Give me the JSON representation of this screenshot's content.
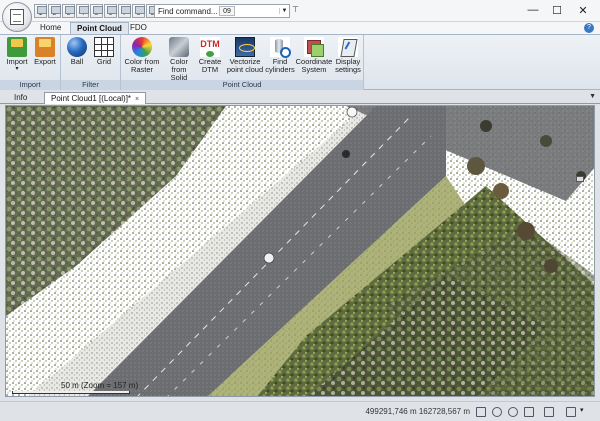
{
  "quick_access": {
    "buttons": [
      "1",
      "2",
      "3",
      "4",
      "5",
      "6",
      "7",
      "8",
      "9"
    ],
    "find_placeholder": "Find command...",
    "find_value": "09"
  },
  "window": {
    "minimize": "—",
    "maximize": "☐",
    "close": "✕"
  },
  "ribbon_tabs": [
    {
      "label": "Home"
    },
    {
      "label": "Point Cloud",
      "active": true
    },
    {
      "label": "FDO"
    }
  ],
  "ribbon": {
    "groups": [
      {
        "label": "Import",
        "buttons": [
          {
            "label": "Import",
            "icon": "import-icon",
            "dropdown": "▾"
          },
          {
            "label": "Export",
            "icon": "export-icon"
          }
        ]
      },
      {
        "label": "Filter",
        "buttons": [
          {
            "label": "Ball",
            "icon": "ball-icon"
          },
          {
            "label": "Grid",
            "icon": "grid-icon"
          }
        ]
      },
      {
        "label": "Point Cloud",
        "buttons": [
          {
            "label": "Color from\nRaster",
            "icon": "color-wheel-icon"
          },
          {
            "label": "Color\nfrom Solid",
            "icon": "solid-color-icon"
          },
          {
            "label": "Create\nDTM",
            "icon": "dtm-icon",
            "icon_text": "DTM"
          },
          {
            "label": "Vectorize\npoint cloud",
            "icon": "vectorize-icon"
          },
          {
            "label": "Find\ncylinders",
            "icon": "cylinder-icon"
          },
          {
            "label": "Coordinate\nSystem",
            "icon": "coordinate-system-icon"
          },
          {
            "label": "Display\nsettings",
            "icon": "display-settings-icon"
          }
        ]
      }
    ]
  },
  "doc_tabs": {
    "info": "Info",
    "active": "Point Cloud1 [(Local)]*",
    "close": "×"
  },
  "viewport": {
    "scale_label": "50 m (Zoom = 157 m)"
  },
  "status": {
    "coordinates": "499291,746 m 162728,567 m"
  },
  "colors": {
    "ribbon_accent": "#a6b6c8",
    "vegetation": "#6a8f2a",
    "road": "#6d6f72"
  }
}
